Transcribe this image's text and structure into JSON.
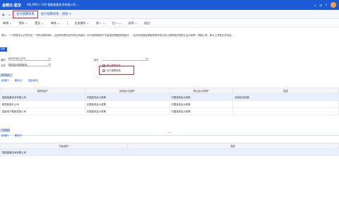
{
  "topbar": {
    "logo": "金蝶云·星空",
    "org": "GN_MES | 100 智能装备技术有限公司 ⌄"
  },
  "tabs": {
    "main": "会计核算体系",
    "sub": "会计核算体系 - 修改 ×"
  },
  "toolbar": [
    "新增 ⌄",
    "保存 ⌄",
    "提交 ⌄",
    "审核 ⌄",
    "业务操作 ⌄",
    "前一 ⌄",
    "后一 ⌄",
    "选项 ⌄",
    "退出"
  ],
  "hint": "提示：一个核算中心必须存在一个默认核算体系，且该体系需包含所有业务组织（作为核算组织时下级组织需被核算组织），会将系统直接提取核算体系中会计核算组织的默认会计政策、获取汇率、默认工资等业务信息。",
  "chip": "基本",
  "form": {
    "code_label": "编码",
    "code_value": "KJHSTX01_SYS",
    "code_tag": "CN",
    "name_label": "名称",
    "name_value": "财务会计核算体系",
    "name_tag": "CN",
    "desc_label": "描述",
    "desc_tag": "CN",
    "chk1": "默认核算体系",
    "chk2": "法人核算体系"
  },
  "section1": "核算组织",
  "entry1_tools": [
    "新增行",
    "删除行",
    "批量填充"
  ],
  "table1": {
    "headers": [
      "核算组织*",
      "适用会计政策*",
      "默认会计政策*",
      "描述"
    ],
    "rows": [
      [
        "智能装备技术有限公司",
        "中国准则会计政策",
        "中国准则会计政策",
        "系统自动创建"
      ],
      [
        "精密制造分公司",
        "中国准则会计政策",
        "中国准则会计政策",
        ""
      ],
      [
        "智能电子集团总部公司",
        "中国准则会计政策",
        "中国准则会计政策",
        ""
      ]
    ]
  },
  "section2": "下级组织",
  "entry2_tools": [
    "新增行",
    "删除行"
  ],
  "table2": {
    "headers": [
      "下级组织*",
      "描述"
    ],
    "rows": [
      [
        "智能装备技术有限公司",
        ""
      ]
    ]
  },
  "colors": {
    "brand": "#1d5bd6",
    "highlight": "#e0282e"
  }
}
